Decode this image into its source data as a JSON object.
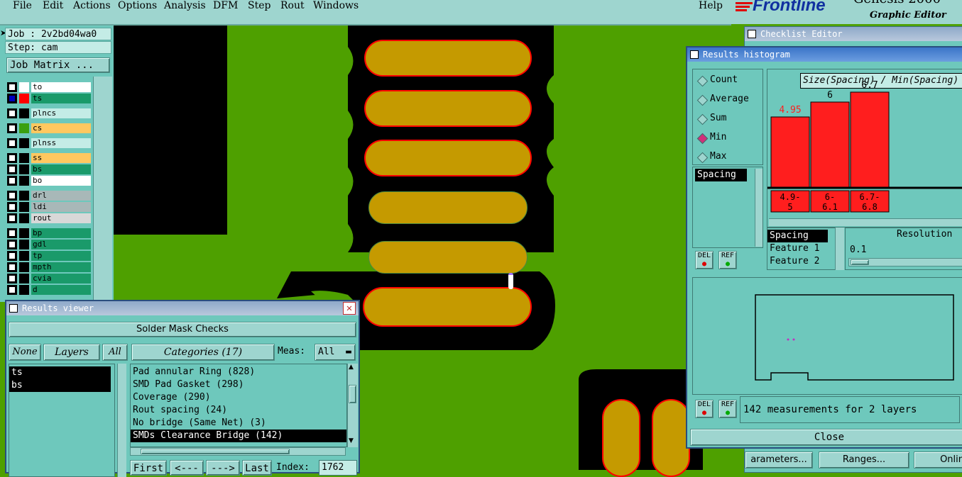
{
  "menu": {
    "items": [
      "File",
      "Edit",
      "Actions",
      "Options",
      "Analysis",
      "DFM",
      "Step",
      "Rout",
      "Windows"
    ],
    "help": "Help"
  },
  "logo": {
    "brand": "Frontline",
    "product": "Genesis 2000",
    "subtitle": "Graphic Editor"
  },
  "left_panel": {
    "job": "Job : 2v2bd04wa0",
    "step": "Step: cam",
    "job_matrix": "Job Matrix ...",
    "layers": [
      {
        "name": "to",
        "color": "#ffffff",
        "swatch": "#ffffff",
        "checked": true
      },
      {
        "name": "ts",
        "color": "#1a9a6a",
        "swatch": "#ff0000",
        "checked": true
      },
      {
        "name": "plncs",
        "color": "#c4ece6",
        "swatch": "#000000",
        "checked": false
      },
      {
        "name": "cs",
        "color": "#ffc860",
        "swatch": "#3aa010",
        "checked": false
      },
      {
        "name": "plnss",
        "color": "#c4ece6",
        "swatch": "#000000",
        "checked": false
      },
      {
        "name": "ss",
        "color": "#ffc860",
        "swatch": "#000000",
        "checked": false
      },
      {
        "name": "bs",
        "color": "#1a9a6a",
        "swatch": "#000000",
        "checked": false
      },
      {
        "name": "bo",
        "color": "#ffffff",
        "swatch": "#000000",
        "checked": false
      },
      {
        "name": "drl",
        "color": "#a8b8b8",
        "swatch": "#000000",
        "checked": false
      },
      {
        "name": "ldi",
        "color": "#a8b8b8",
        "swatch": "#000000",
        "checked": false
      },
      {
        "name": "rout",
        "color": "#d8d8d8",
        "swatch": "#000000",
        "checked": false
      },
      {
        "name": "bp",
        "color": "#1a9a6a",
        "swatch": "#000000",
        "checked": false
      },
      {
        "name": "gdl",
        "color": "#1a9a6a",
        "swatch": "#000000",
        "checked": false
      },
      {
        "name": "tp",
        "color": "#1a9a6a",
        "swatch": "#000000",
        "checked": false
      },
      {
        "name": "mpth",
        "color": "#1a9a6a",
        "swatch": "#000000",
        "checked": false
      },
      {
        "name": "cvia",
        "color": "#1a9a6a",
        "swatch": "#000000",
        "checked": false
      },
      {
        "name": "d",
        "color": "#1a9a6a",
        "swatch": "#000000",
        "checked": false
      }
    ]
  },
  "results_viewer": {
    "title": "Results viewer",
    "header": "Solder Mask Checks",
    "none": "None",
    "layers_btn": "Layers",
    "all": "All",
    "categories": "Categories (17)",
    "meas_label": "Meas:",
    "meas_value": "All",
    "layer_list": [
      "ts",
      "bs"
    ],
    "category_list": [
      {
        "label": "Pad annular Ring (828)",
        "selected": false
      },
      {
        "label": "SMD Pad Gasket (298)",
        "selected": false
      },
      {
        "label": "Coverage (290)",
        "selected": false
      },
      {
        "label": "Rout spacing (24)",
        "selected": false
      },
      {
        "label": "No bridge (Same Net) (3)",
        "selected": false
      },
      {
        "label": "SMDs Clearance Bridge (142)",
        "selected": true
      }
    ],
    "first": "First",
    "prev": "<---",
    "next": "--->",
    "last": "Last",
    "index_label": "Index:",
    "index_value": "1762"
  },
  "checklist_editor": {
    "title": "Checklist Editor",
    "parameters": "arameters...",
    "ranges": "Ranges...",
    "online": "Onlin"
  },
  "histogram": {
    "title": "Results histogram",
    "modes": [
      {
        "label": "Count",
        "on": false
      },
      {
        "label": "Average",
        "on": false
      },
      {
        "label": "Sum",
        "on": false
      },
      {
        "label": "Min",
        "on": true
      },
      {
        "label": "Max",
        "on": false
      }
    ],
    "measure_list": [
      "Spacing"
    ],
    "chart_title": "Size(Spacing) / Min(Spacing)",
    "del": "DEL",
    "ref": "REF",
    "sort_list": [
      {
        "label": "Spacing",
        "selected": true
      },
      {
        "label": "Feature 1",
        "selected": false
      },
      {
        "label": "Feature 2",
        "selected": false
      }
    ],
    "resolution_label": "Resolution",
    "resolution_value": "0.1",
    "status": "142 measurements for 2 layers",
    "close": "Close"
  },
  "chart_data": {
    "type": "bar",
    "title": "Size(Spacing) / Min(Spacing)",
    "categories": [
      "4.9-5",
      "6-6.1",
      "6.7-6.8"
    ],
    "category_lines": [
      [
        "4.9-",
        "5"
      ],
      [
        "6-",
        "6.1"
      ],
      [
        "6.7-",
        "6.8"
      ]
    ],
    "values": [
      4.95,
      6,
      6.7
    ],
    "value_labels": [
      "4.95",
      "6",
      "6.7"
    ],
    "ylim": [
      0,
      7.5
    ],
    "bar_color": "#ff1e1e"
  }
}
